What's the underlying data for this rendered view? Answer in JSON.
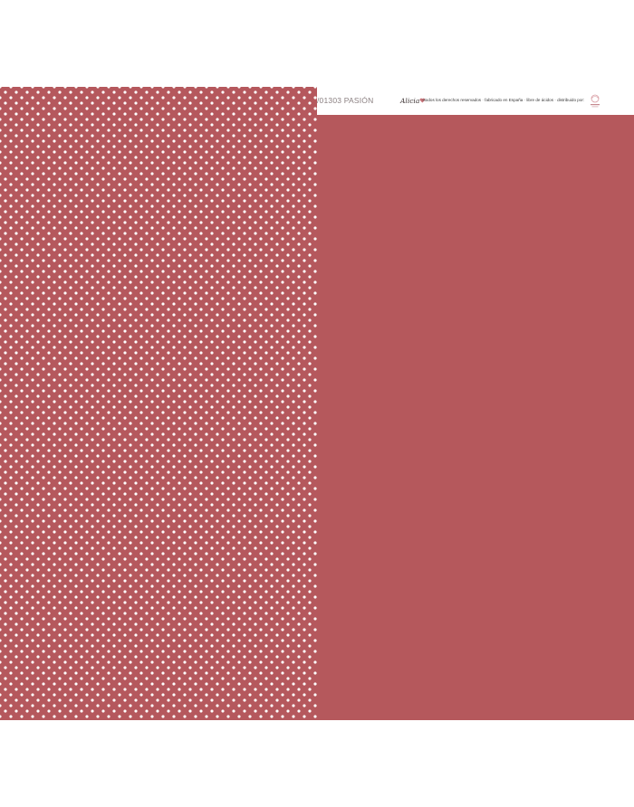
{
  "product": {
    "reference": "/01303 PASIÓN",
    "brand": "Alicia",
    "legal": "≈todos los derechos reservados · fabricado en España · libre de ácidos · distribuido por:"
  },
  "colors": {
    "left_background": "#b5585d",
    "right_background": "#b5585c",
    "dot": "#ffffff"
  },
  "patterns": {
    "left": "white polka dots",
    "right": "solid"
  },
  "icons": {
    "brand_logo": "brand-logo-icon",
    "distributor_logo": "distributor-logo-icon"
  }
}
